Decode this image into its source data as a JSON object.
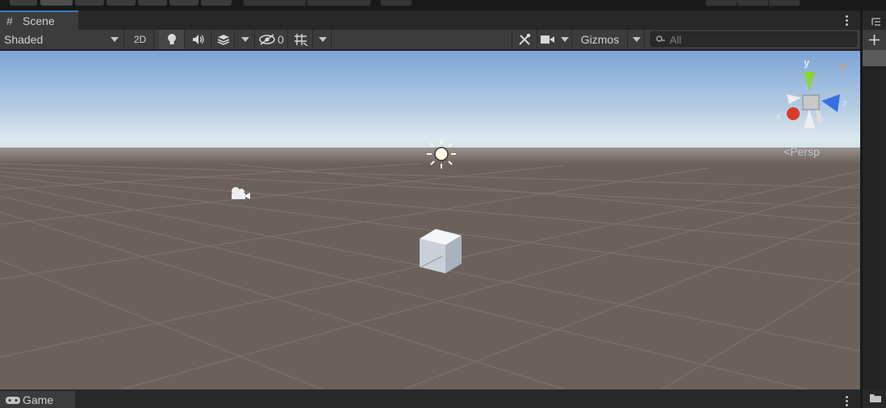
{
  "tabs": {
    "scene": "Scene",
    "game": "Game"
  },
  "toolbar": {
    "shading_mode": "Shaded",
    "mode_2d": "2D",
    "hidden_count": "0",
    "gizmos_label": "Gizmos",
    "search_placeholder": "All"
  },
  "viewport": {
    "camera_projection": "Persp",
    "gizmo_axes": {
      "x": "x",
      "y": "y",
      "z": "z"
    },
    "objects": [
      "directional-light",
      "main-camera",
      "cube"
    ]
  },
  "colors": {
    "accent_tab": "#3a79bb",
    "ground": "#6b615c",
    "sky_top": "#7da4d6",
    "sky_horizon": "#dde9ef",
    "axis_x": "#db3b26",
    "axis_y": "#8cd43a",
    "axis_z": "#3a6ee0"
  },
  "icons": [
    "grid-icon",
    "lightbulb-icon",
    "audio-icon",
    "effects-icon",
    "visibility-icon",
    "grid-snap-icon",
    "tools-icon",
    "camera-icon",
    "search-icon",
    "kebab-menu-icon",
    "plus-icon",
    "hierarchy-icon",
    "folder-icon",
    "gamepad-icon"
  ]
}
